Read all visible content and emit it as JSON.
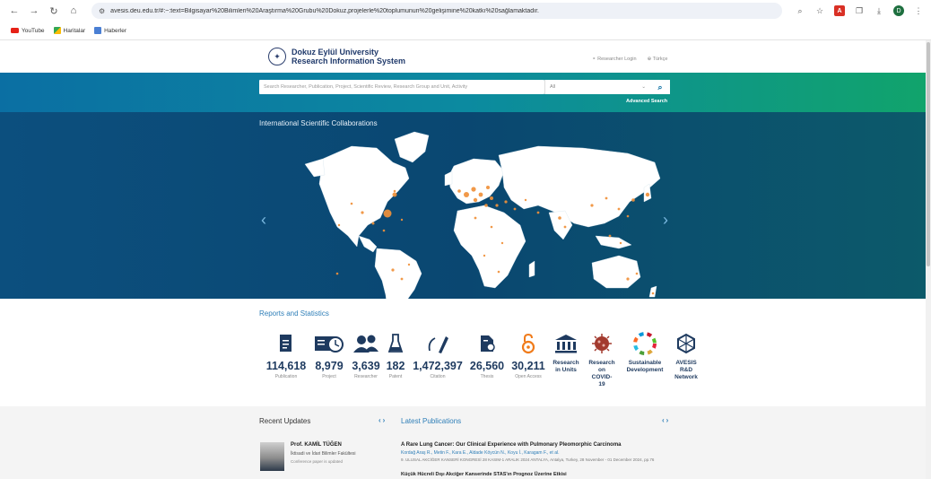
{
  "browser": {
    "url": "avesis.deu.edu.tr/#:~:text=Bilgisayar%20Bilimleri%20Araştırma%20Grubu%20Dokuz,projelerle%20toplumunun%20gelişimine%20katkı%20sağlamaktadır.",
    "bookmarks": [
      {
        "label": "YouTube"
      },
      {
        "label": "Haritalar"
      },
      {
        "label": "Haberler"
      }
    ],
    "profile_initial": "D"
  },
  "header": {
    "university": "Dokuz Eylül University",
    "system": "Research Information System",
    "login_label": "Researcher Login",
    "language_label": "Türkçe"
  },
  "search": {
    "placeholder": "Search Researcher, Publication, Project, Scientific Review, Research Group and Unit, Activity",
    "filter_value": "All",
    "advanced_label": "Advanced Search"
  },
  "hero": {
    "title": "International Scientific Collaborations"
  },
  "stats": {
    "title": "Reports and Statistics",
    "items": [
      {
        "value": "114,618",
        "label": "Publication",
        "icon": "publication-icon"
      },
      {
        "value": "8,979",
        "label": "Project",
        "icon": "project-icon"
      },
      {
        "value": "3,639",
        "label": "Researcher",
        "icon": "researcher-icon"
      },
      {
        "value": "182",
        "label": "Patent",
        "icon": "patent-icon"
      },
      {
        "value": "1,472,397",
        "label": "Citation",
        "icon": "citation-icon"
      },
      {
        "value": "26,560",
        "label": "Thesis",
        "icon": "thesis-icon"
      },
      {
        "value": "30,211",
        "label": "Open Access",
        "icon": "open-access-icon"
      }
    ],
    "links": [
      {
        "l1": "Research",
        "l2": "in Units",
        "l3": "",
        "l4": ""
      },
      {
        "l1": "Research",
        "l2": "on",
        "l3": "COVID-",
        "l4": "19"
      },
      {
        "l1": "Sustainable",
        "l2": "Development",
        "l3": "",
        "l4": ""
      },
      {
        "l1": "AVESIS",
        "l2": "R&D",
        "l3": "Network",
        "l4": ""
      }
    ]
  },
  "updates": {
    "recent_title": "Recent Updates",
    "latest_title": "Latest Publications",
    "person": {
      "name": "Prof. KAMİL TÜĞEN",
      "dept": "İktisadi ve İdari Bilimler Fakültesi",
      "note": "Conference paper is updated"
    },
    "publication": {
      "title": "A Rare Lung Cancer: Our Clinical Experience with Pulmonary Pleomorphic Carcinoma",
      "authors": "Kordağ Araş R., Metin F., Kara E., Aldade Köycün N., Koyu İ., Karagam F., et al.",
      "venue": "9. ULUSAL AKCİĞER KANSERİ KONGRESİ 28 KASIM-1 ARALIK 2024 ANTALYA, Antalya, Turkey, 28 November - 01 December 2024, pp.76"
    },
    "next_publication_title": "Küçük Hücreli Dışı Akciğer Kanserinde STAS'ın Prognoz Üzerine Etkisi"
  }
}
